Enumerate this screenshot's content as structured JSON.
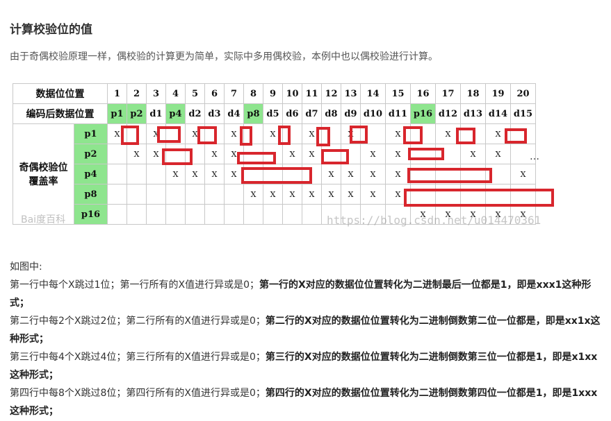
{
  "title": "计算校验位的值",
  "intro": "由于奇偶校验原理一样，偶校验的计算更为简单，实际中多用偶校验，本例中也以偶校验进行计算。",
  "table": {
    "header_label": "数据位位置",
    "positions": [
      "1",
      "2",
      "3",
      "4",
      "5",
      "6",
      "7",
      "8",
      "9",
      "10",
      "11",
      "12",
      "13",
      "14",
      "15",
      "16",
      "17",
      "18",
      "19",
      "20"
    ],
    "encoded_label": "编码后数据位置",
    "encoded": [
      "p1",
      "p2",
      "d1",
      "p4",
      "d2",
      "d3",
      "d4",
      "p8",
      "d5",
      "d6",
      "d7",
      "d8",
      "d9",
      "d10",
      "d11",
      "p16",
      "d12",
      "d13",
      "d14",
      "d15"
    ],
    "parity_highlight": [
      0,
      1,
      3,
      7,
      15
    ],
    "coverage_label_1": "奇偶校验位",
    "coverage_label_2": "覆盖率",
    "mark": "X",
    "rows": [
      {
        "label": "p1",
        "marks": [
          1,
          0,
          1,
          0,
          1,
          0,
          1,
          0,
          1,
          0,
          1,
          0,
          1,
          0,
          1,
          0,
          1,
          0,
          1,
          0
        ]
      },
      {
        "label": "p2",
        "marks": [
          0,
          1,
          1,
          0,
          0,
          1,
          1,
          0,
          0,
          1,
          1,
          0,
          0,
          1,
          1,
          0,
          0,
          1,
          1,
          0
        ]
      },
      {
        "label": "p4",
        "marks": [
          0,
          0,
          0,
          1,
          1,
          1,
          1,
          0,
          0,
          0,
          0,
          1,
          1,
          1,
          1,
          0,
          0,
          0,
          0,
          1
        ]
      },
      {
        "label": "p8",
        "marks": [
          0,
          0,
          0,
          0,
          0,
          0,
          0,
          1,
          1,
          1,
          1,
          1,
          1,
          1,
          1,
          0,
          0,
          0,
          0,
          0
        ]
      },
      {
        "label": "p16",
        "marks": [
          0,
          0,
          0,
          0,
          0,
          0,
          0,
          0,
          0,
          0,
          0,
          0,
          0,
          0,
          0,
          1,
          1,
          1,
          1,
          1
        ]
      }
    ],
    "ellipsis": "…"
  },
  "watermark_url": "https://blog.csdn.net/u014470361",
  "watermark_logo": "Bai度百科",
  "explanation": {
    "intro": "如图中:",
    "lines": [
      {
        "normal": "第一行中每个X跳过1位；第一行所有的X值进行异或是0；",
        "bold": "第一行的X对应的数据位位置转化为二进制最后一位都是1，即是xxx1这种形式；"
      },
      {
        "normal": "第二行中每2个X跳过2位；第二行所有的X值进行异或是0；",
        "bold": "第二行的X对应的数据位位置转化为二进制倒数第二位一位都是，即是xx1x这种形式；"
      },
      {
        "normal": "第三行中每4个X跳过4位；第三行所有的X值进行异或是0；",
        "bold": "第三行的X对应的数据位位置转化为二进制倒数第三位一位都是1，即是x1xx这种形式；"
      },
      {
        "normal": "第四行中每8个X跳过8位；第四行所有的X值进行异或是0；",
        "bold": "第四行的X对应的数据位位置转化为二进制倒数第四位一位都是1，即是1xxx这种形式；"
      }
    ]
  }
}
